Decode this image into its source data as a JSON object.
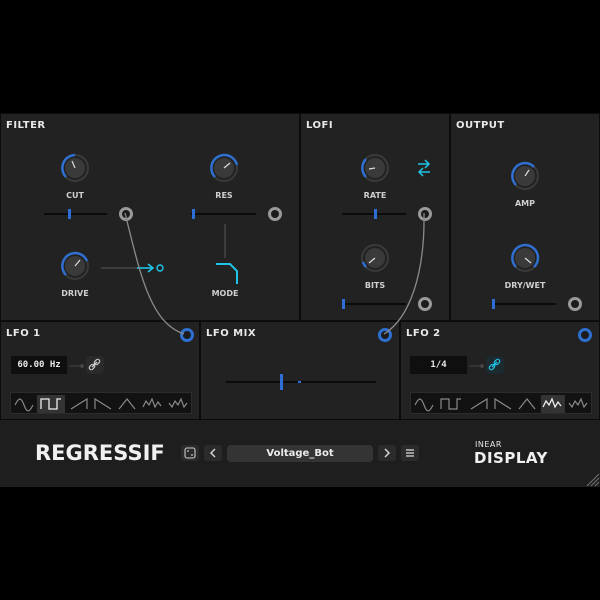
{
  "sections": {
    "filter": {
      "title": "FILTER",
      "knobs": [
        {
          "label": "CUT"
        },
        {
          "label": "RES"
        },
        {
          "label": "DRIVE"
        },
        {
          "label": "MODE"
        }
      ]
    },
    "lofi": {
      "title": "LOFI",
      "knobs": [
        {
          "label": "RATE"
        },
        {
          "label": "BITS"
        }
      ]
    },
    "output": {
      "title": "OUTPUT",
      "knobs": [
        {
          "label": "AMP"
        },
        {
          "label": "DRY/WET"
        }
      ]
    }
  },
  "lfo1": {
    "title": "LFO 1",
    "rate": "60.00 Hz"
  },
  "lfo_mix": {
    "title": "LFO MIX"
  },
  "lfo2": {
    "title": "LFO 2",
    "rate": "1/4"
  },
  "footer": {
    "logo": "REGRESSIF",
    "preset_name": "Voltage_Bot",
    "brand_top": "INEAR",
    "brand_bottom": "DISPLAY"
  },
  "colors": {
    "accent_blue": "#2f6fd0",
    "accent_cyan": "#1fc4e8",
    "panel_bg": "#222222"
  },
  "icons": [
    "swap-arrows-icon",
    "link-icon",
    "dice-icon",
    "chevron-left-icon",
    "chevron-right-icon",
    "menu-icon"
  ]
}
